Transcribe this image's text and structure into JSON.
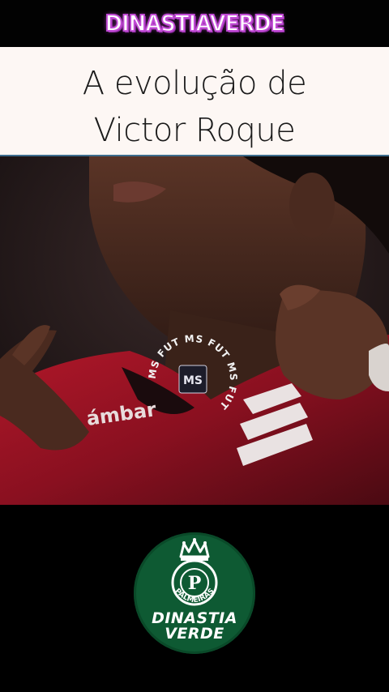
{
  "header": {
    "brand_title": "DINASTIAVERDE"
  },
  "caption": {
    "line1": "A evolução de",
    "line2": "Victor Roque"
  },
  "video": {
    "watermark_ring_text": "MS FUT MS FUT MS FUT",
    "watermark_logo": "MS",
    "jersey_text": "ámbar"
  },
  "badge": {
    "crest_letter": "P",
    "crest_text": "PALMEIRAS",
    "line1": "DINASTIA",
    "line2": "VERDE"
  },
  "colors": {
    "brand_stroke": "#c24bd6",
    "caption_bg": "#fdf7f4",
    "badge_green": "#0e5a33",
    "jersey_red": "#9e1422"
  }
}
